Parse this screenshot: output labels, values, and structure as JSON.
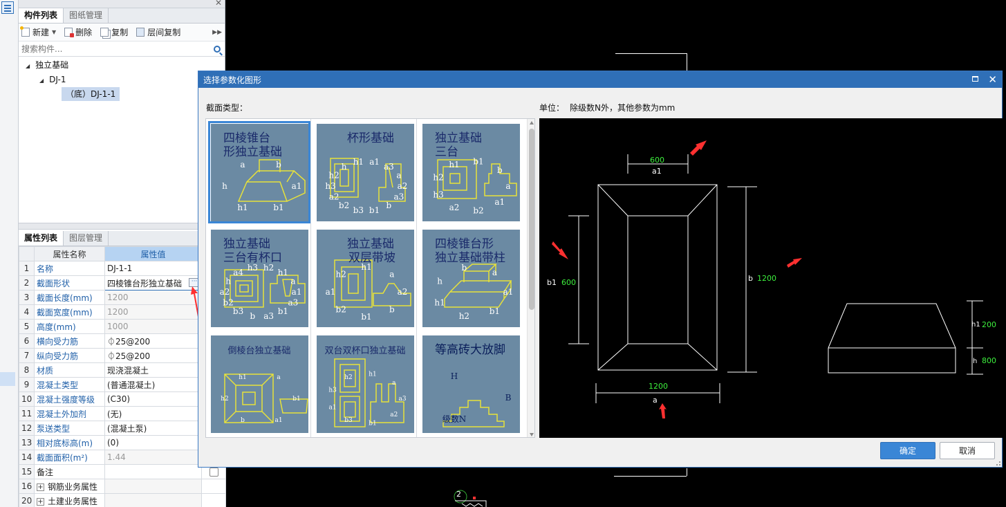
{
  "left_panel": {
    "tabs": [
      "构件列表",
      "图纸管理"
    ],
    "toolbar": {
      "new": "新建",
      "delete": "删除",
      "copy": "复制",
      "floor_copy": "层间复制"
    },
    "search_placeholder": "搜索构件...",
    "tree": {
      "root": "独立基础",
      "child": "DJ-1",
      "leaf": "（底）DJ-1-1"
    }
  },
  "properties": {
    "tabs": [
      "属性列表",
      "图层管理"
    ],
    "header": {
      "name": "属性名称",
      "value": "属性值"
    },
    "rows": [
      {
        "n": "1",
        "name": "名称",
        "value": "DJ-1-1"
      },
      {
        "n": "2",
        "name": "截面形状",
        "value": "四棱锥台形独立基础"
      },
      {
        "n": "3",
        "name": "截面长度(mm)",
        "value": "1200"
      },
      {
        "n": "4",
        "name": "截面宽度(mm)",
        "value": "1200"
      },
      {
        "n": "5",
        "name": "高度(mm)",
        "value": "1000"
      },
      {
        "n": "6",
        "name": "横向受力筋",
        "value": "⏀25@200"
      },
      {
        "n": "7",
        "name": "纵向受力筋",
        "value": "⏀25@200"
      },
      {
        "n": "8",
        "name": "材质",
        "value": "现浇混凝土"
      },
      {
        "n": "9",
        "name": "混凝土类型",
        "value": "(普通混凝土)"
      },
      {
        "n": "10",
        "name": "混凝土强度等级",
        "value": "(C30)"
      },
      {
        "n": "11",
        "name": "混凝土外加剂",
        "value": "(无)"
      },
      {
        "n": "12",
        "name": "泵送类型",
        "value": "(混凝土泵)"
      },
      {
        "n": "13",
        "name": "相对底标高(m)",
        "value": "(0)"
      },
      {
        "n": "14",
        "name": "截面面积(m²)",
        "value": "1.44"
      },
      {
        "n": "15",
        "name": "备注",
        "value": ""
      },
      {
        "n": "16",
        "name": "钢筋业务属性",
        "value": ""
      },
      {
        "n": "20",
        "name": "土建业务属性",
        "value": ""
      }
    ]
  },
  "dialog": {
    "title": "选择参数化图形",
    "section_label": "截面类型：",
    "unit_label": "单位：",
    "unit_text": "除级数N外，其他参数为mm",
    "ok": "确定",
    "cancel": "取消",
    "shapes": [
      {
        "title1": "四棱锥台",
        "title2": "形独立基础",
        "labels": [
          "a1",
          "b1",
          "h1",
          "h",
          "a",
          "b"
        ]
      },
      {
        "title1": "杯形基础",
        "title2": "",
        "labels": [
          "a2",
          "a3",
          "b",
          "b1",
          "b3",
          "b2",
          "a2",
          "h3",
          "h2",
          "h",
          "h1",
          "a1",
          "a3",
          "a"
        ]
      },
      {
        "title1": "独立基础",
        "title2": "三台",
        "labels": [
          "a",
          "a1",
          "b2",
          "a2",
          "h3",
          "h2",
          "h1",
          "b1",
          "b"
        ]
      },
      {
        "title1": "独立基础",
        "title2": "三台有杯口",
        "labels": [
          "a1",
          "a3",
          "b1",
          "a3",
          "b",
          "b3",
          "b2",
          "a2",
          "h",
          "a4",
          "h3",
          "h2",
          "h1",
          "a"
        ]
      },
      {
        "title1": "独立基础",
        "title2": "双层带坡",
        "labels": [
          "a2",
          "b",
          "b1",
          "b2",
          "a1",
          "h2",
          "h1",
          "a"
        ]
      },
      {
        "title1": "四棱锥台形",
        "title2": "独立基础带柱",
        "labels": [
          "a1",
          "b1",
          "h2",
          "h1",
          "h",
          "b",
          "a"
        ]
      },
      {
        "title1": "倒棱台独立基础",
        "title2": "",
        "labels": [
          "b1",
          "a1",
          "b",
          "h2",
          "h1",
          "a"
        ]
      },
      {
        "title1": "双台双杯口独立基础",
        "title2": "",
        "labels": [
          "a3",
          "a2",
          "b1",
          "b3",
          "a1",
          "h3",
          "h2",
          "h1",
          "a"
        ]
      },
      {
        "title1": "等高砖大放脚",
        "title2": "",
        "labels": [
          "B",
          "级数N",
          "H"
        ]
      }
    ],
    "preview": {
      "top_value": "600",
      "top_label": "a1",
      "left_label": "b1",
      "left_value": "600",
      "right_label": "b",
      "right_value": "1200",
      "bottom_value": "1200",
      "bottom_label": "a",
      "h1_label": "h1",
      "h1_value": "200",
      "h_label": "h",
      "h_value": "800"
    }
  },
  "colors": {
    "accent": "#2f6fb7",
    "thumb_bg": "#6b8aa3",
    "thumb_line": "#e8e23a",
    "dim_green": "#3df03d",
    "red_arrow": "#ff3030"
  }
}
